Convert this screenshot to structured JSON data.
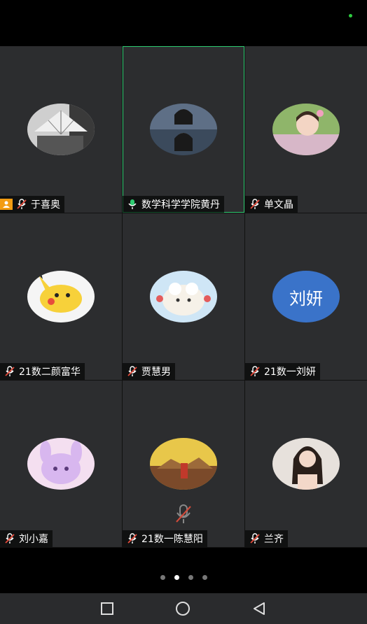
{
  "participants": [
    {
      "name": "于喜奥",
      "avatar": "fan-photo",
      "is_host": true
    },
    {
      "name": "数学科学学院黄丹",
      "avatar": "photo-woman-dual",
      "speaking": true
    },
    {
      "name": "单文晶",
      "avatar": "photo-child"
    },
    {
      "name": "21数二颜富华",
      "avatar": "pikachu-cartoon"
    },
    {
      "name": "贾慧男",
      "avatar": "sheep-cartoon"
    },
    {
      "name": "21数一刘妍",
      "avatar_text": "刘妍"
    },
    {
      "name": "刘小嘉",
      "avatar": "stellalou-cartoon"
    },
    {
      "name": "21数一陈慧阳",
      "avatar": "landscape-photo"
    },
    {
      "name": "兰齐",
      "avatar": "photo-woman"
    }
  ],
  "pagination": {
    "pages": 4,
    "current": 2
  },
  "nav": {
    "recent": "square-icon",
    "home": "circle-icon",
    "back": "triangle-icon"
  },
  "colors": {
    "tile_bg": "#2c2d2f",
    "speaking_border": "#2ecc71",
    "host_badge": "#f39c12",
    "text_avatar": "#3a73c9"
  }
}
